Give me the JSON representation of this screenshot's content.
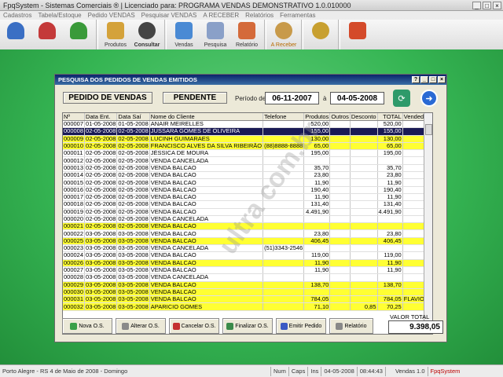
{
  "window": {
    "title": "FpqSystem - Sistemas Comerciais ® | Licenciado para: PROGRAMA VENDAS DEMONSTRATIVO 1.0.010000"
  },
  "menu": [
    "Cadastros",
    "Tabela/Estoque",
    "Pedido VENDAS",
    "Pesquisar VENDAS",
    "A RECEBER",
    "Relatórios",
    "Ferramentas"
  ],
  "toolbar": [
    {
      "label": "",
      "icon": "user-blue-icon",
      "color": "#3a6fc4"
    },
    {
      "label": "",
      "icon": "user-red-icon",
      "color": "#c43a3a"
    },
    {
      "label": "",
      "icon": "user-green-icon",
      "color": "#3a9a3a"
    },
    {
      "label": "Produtos",
      "icon": "boxes-icon",
      "color": "#d4a23a"
    },
    {
      "label": "Consultar",
      "icon": "film-icon",
      "color": "#444444"
    },
    {
      "label": "Vendas",
      "icon": "monitor-icon",
      "color": "#4a8ad4"
    },
    {
      "label": "Pesquisa",
      "icon": "magnify-icon",
      "color": "#8aa0c8"
    },
    {
      "label": "Relatório",
      "icon": "chart-icon",
      "color": "#d46a3a"
    },
    {
      "label": "A Receber",
      "icon": "money-bag-icon",
      "color": "#c89a4a"
    },
    {
      "label": "",
      "icon": "coin-icon",
      "color": "#c8a030"
    },
    {
      "label": "",
      "icon": "exit-icon",
      "color": "#d44a2a"
    }
  ],
  "dialog": {
    "title": "PESQUISA DOS PEDIDOS DE VENDAS EMITIDOS",
    "heading": "PEDIDO DE VENDAS",
    "status": "PENDENTE",
    "periodo_label": "Período de",
    "date_from": "06-11-2007",
    "a_label": "à",
    "date_to": "04-05-2008",
    "columns": [
      "Nº",
      "Data Ent.",
      "Data Saí",
      "Nome do Cliente",
      "Telefone",
      "Produtos",
      "Outros",
      "Desconto",
      "TOTAL",
      "Vendedor"
    ],
    "rows": [
      {
        "n": "000007",
        "de": "01-05-2008",
        "ds": "01-05-2008",
        "nome": "ANAIR MEIRELLES",
        "tel": "",
        "prod": "520,00",
        "out": "",
        "desc": "",
        "total": "520,00",
        "vend": "",
        "style": "white"
      },
      {
        "n": "000008",
        "de": "02-05-2008",
        "ds": "02-05-2008",
        "nome": "JUSSARA GOMES DE OLIVEIRA",
        "tel": "",
        "prod": "155,00",
        "out": "",
        "desc": "",
        "total": "155,00",
        "vend": "",
        "style": "sel"
      },
      {
        "n": "000009",
        "de": "02-05-2008",
        "ds": "02-05-2008",
        "nome": "LUCINH GUIMARAES",
        "tel": "",
        "prod": "130,00",
        "out": "",
        "desc": "",
        "total": "130,00",
        "vend": "",
        "style": "yellow"
      },
      {
        "n": "000010",
        "de": "02-05-2008",
        "ds": "02-05-2008",
        "nome": "FRANCISCO ALVES DA SILVA RIBEIRÃO",
        "tel": "(88)8888-8888",
        "prod": "65,00",
        "out": "",
        "desc": "",
        "total": "65,00",
        "vend": "",
        "style": "yellow"
      },
      {
        "n": "000011",
        "de": "02-05-2008",
        "ds": "02-05-2008",
        "nome": "JÉSSICA DE MOURA",
        "tel": "",
        "prod": "195,00",
        "out": "",
        "desc": "",
        "total": "195,00",
        "vend": "",
        "style": "white"
      },
      {
        "n": "000012",
        "de": "02-05-2008",
        "ds": "02-05-2008",
        "nome": "VENDA CANCELADA",
        "tel": "",
        "prod": "",
        "out": "",
        "desc": "",
        "total": "",
        "vend": "",
        "style": "white"
      },
      {
        "n": "000013",
        "de": "02-05-2008",
        "ds": "02-05-2008",
        "nome": "VENDA BALCAO",
        "tel": "",
        "prod": "35,70",
        "out": "",
        "desc": "",
        "total": "35,70",
        "vend": "",
        "style": "white"
      },
      {
        "n": "000014",
        "de": "02-05-2008",
        "ds": "02-05-2008",
        "nome": "VENDA BALCAO",
        "tel": "",
        "prod": "23,80",
        "out": "",
        "desc": "",
        "total": "23,80",
        "vend": "",
        "style": "white"
      },
      {
        "n": "000015",
        "de": "02-05-2008",
        "ds": "02-05-2008",
        "nome": "VENDA BALCAO",
        "tel": "",
        "prod": "11,90",
        "out": "",
        "desc": "",
        "total": "11,90",
        "vend": "",
        "style": "white"
      },
      {
        "n": "000016",
        "de": "02-05-2008",
        "ds": "02-05-2008",
        "nome": "VENDA BALCAO",
        "tel": "",
        "prod": "190,40",
        "out": "",
        "desc": "",
        "total": "190,40",
        "vend": "",
        "style": "white"
      },
      {
        "n": "000017",
        "de": "02-05-2008",
        "ds": "02-05-2008",
        "nome": "VENDA BALCAO",
        "tel": "",
        "prod": "11,90",
        "out": "",
        "desc": "",
        "total": "11,90",
        "vend": "",
        "style": "white"
      },
      {
        "n": "000018",
        "de": "02-05-2008",
        "ds": "02-05-2008",
        "nome": "VENDA BALCAO",
        "tel": "",
        "prod": "131,40",
        "out": "",
        "desc": "",
        "total": "131,40",
        "vend": "",
        "style": "white"
      },
      {
        "n": "000019",
        "de": "02-05-2008",
        "ds": "02-05-2008",
        "nome": "VENDA BALCAO",
        "tel": "",
        "prod": "4.491,90",
        "out": "",
        "desc": "",
        "total": "4.491,90",
        "vend": "",
        "style": "white"
      },
      {
        "n": "000020",
        "de": "02-05-2008",
        "ds": "02-05-2008",
        "nome": "VENDA CANCELADA",
        "tel": "",
        "prod": "",
        "out": "",
        "desc": "",
        "total": "",
        "vend": "",
        "style": "white"
      },
      {
        "n": "000021",
        "de": "02-05-2008",
        "ds": "02-05-2008",
        "nome": "VENDA BALCAO",
        "tel": "",
        "prod": "",
        "out": "",
        "desc": "",
        "total": "",
        "vend": "",
        "style": "yellow"
      },
      {
        "n": "000022",
        "de": "03-05-2008",
        "ds": "03-05-2008",
        "nome": "VENDA BALCAO",
        "tel": "",
        "prod": "23,80",
        "out": "",
        "desc": "",
        "total": "23,80",
        "vend": "",
        "style": "white"
      },
      {
        "n": "000025",
        "de": "03-05-2008",
        "ds": "03-05-2008",
        "nome": "VENDA BALCAO",
        "tel": "",
        "prod": "406,45",
        "out": "",
        "desc": "",
        "total": "406,45",
        "vend": "",
        "style": "yellow"
      },
      {
        "n": "000023",
        "de": "03-05-2008",
        "ds": "03-05-2008",
        "nome": "VENDA CANCELADA",
        "tel": "(51)3343-2546",
        "prod": "",
        "out": "",
        "desc": "",
        "total": "",
        "vend": "",
        "style": "white"
      },
      {
        "n": "000024",
        "de": "03-05-2008",
        "ds": "03-05-2008",
        "nome": "VENDA BALCAO",
        "tel": "",
        "prod": "119,00",
        "out": "",
        "desc": "",
        "total": "119,00",
        "vend": "",
        "style": "white"
      },
      {
        "n": "000026",
        "de": "03-05-2008",
        "ds": "03-05-2008",
        "nome": "VENDA BALCAO",
        "tel": "",
        "prod": "11,90",
        "out": "",
        "desc": "",
        "total": "11,90",
        "vend": "",
        "style": "yellow"
      },
      {
        "n": "000027",
        "de": "03-05-2008",
        "ds": "03-05-2008",
        "nome": "VENDA BALCAO",
        "tel": "",
        "prod": "11,90",
        "out": "",
        "desc": "",
        "total": "11,90",
        "vend": "",
        "style": "white"
      },
      {
        "n": "000028",
        "de": "03-05-2008",
        "ds": "03-05-2008",
        "nome": "VENDA CANCELADA",
        "tel": "",
        "prod": "",
        "out": "",
        "desc": "",
        "total": "",
        "vend": "",
        "style": "white"
      },
      {
        "n": "000029",
        "de": "03-05-2008",
        "ds": "03-05-2008",
        "nome": "VENDA BALCAO",
        "tel": "",
        "prod": "138,70",
        "out": "",
        "desc": "",
        "total": "138,70",
        "vend": "",
        "style": "yellow"
      },
      {
        "n": "000030",
        "de": "03-05-2008",
        "ds": "03-05-2008",
        "nome": "VENDA BALCAO",
        "tel": "",
        "prod": "",
        "out": "",
        "desc": "",
        "total": "",
        "vend": "",
        "style": "yellow"
      },
      {
        "n": "000031",
        "de": "03-05-2008",
        "ds": "03-05-2008",
        "nome": "VENDA BALCAO",
        "tel": "",
        "prod": "784,05",
        "out": "",
        "desc": "",
        "total": "784,05",
        "vend": "FLAVIO QU",
        "style": "yellow"
      },
      {
        "n": "000032",
        "de": "03-05-2008",
        "ds": "03-05-2008",
        "nome": "APARICIO GOMES",
        "tel": "",
        "prod": "71,10",
        "out": "",
        "desc": "0,85",
        "total": "70,25",
        "vend": "",
        "style": "yellow"
      }
    ],
    "buttons": [
      {
        "id": "nova-os-button",
        "label": "Nova O.S.",
        "color": "#3aa04a"
      },
      {
        "id": "alterar-os-button",
        "label": "Alterar O.S.",
        "color": "#8a8a8a"
      },
      {
        "id": "cancelar-os-button",
        "label": "Cancelar O.S.",
        "color": "#c43030"
      },
      {
        "id": "finalizar-os-button",
        "label": "Finalizar O.S.",
        "color": "#3a8a4a"
      },
      {
        "id": "emitir-pedido-button",
        "label": "Emitir Pedido",
        "color": "#3a5ac4"
      },
      {
        "id": "relatorio-button",
        "label": "Relatório",
        "color": "#888888"
      }
    ],
    "valor_total_label": "VALOR TOTAL",
    "valor_total": "9.398,05"
  },
  "statusbar": [
    "Porto Alegre - RS   4 de Maio de 2008 - Domingo",
    "Num",
    "Caps",
    "Ins",
    "04-05-2008",
    "08:44:43",
    "Vendas 1.0",
    "FpqSystem"
  ],
  "watermark": "ultra com.br"
}
